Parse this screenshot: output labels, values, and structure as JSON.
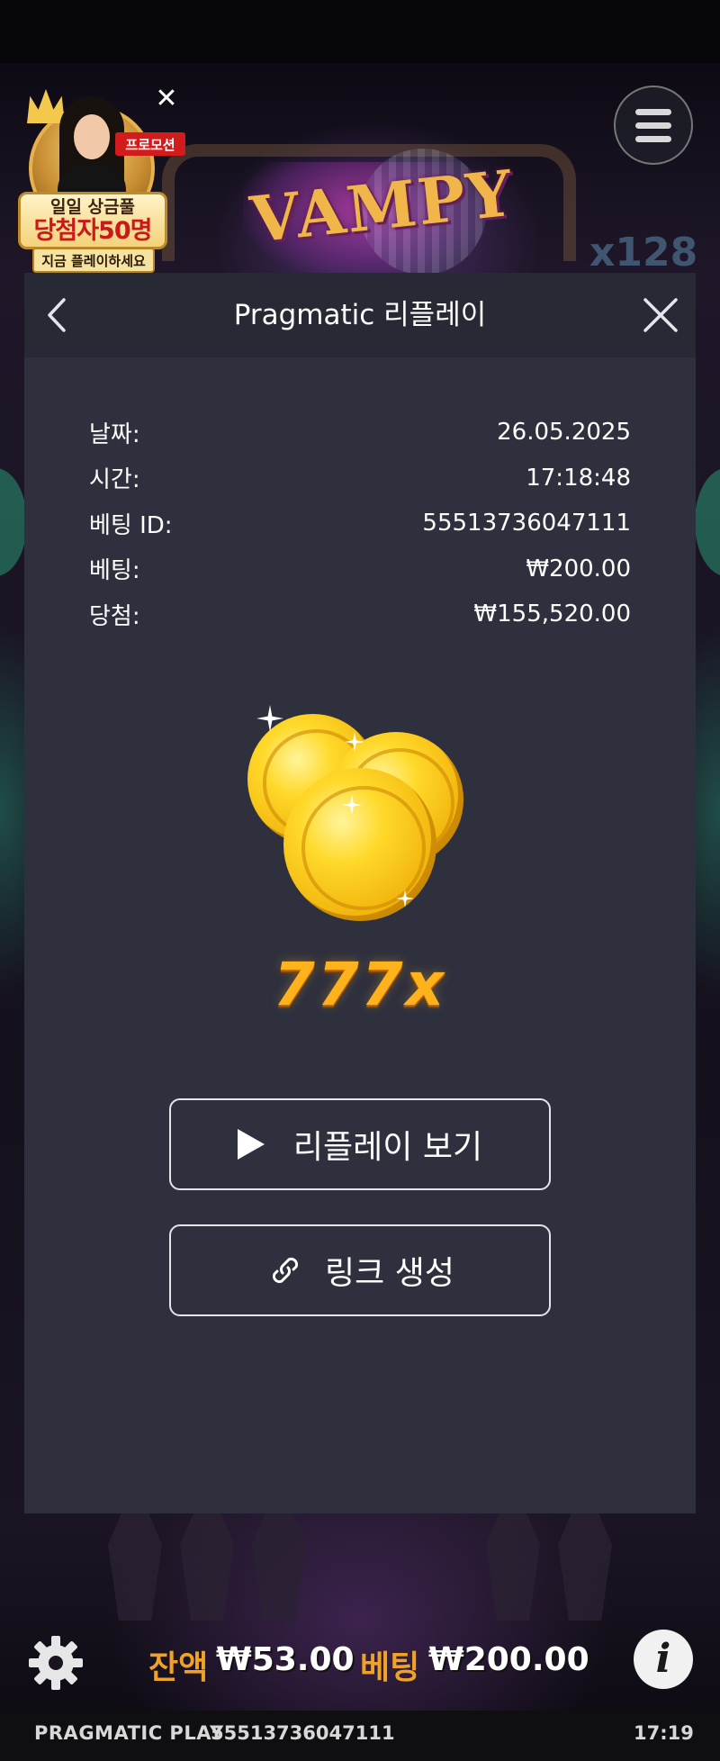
{
  "game": {
    "logo_text": "VAMPY",
    "multiplier_badge": "x128"
  },
  "promo": {
    "tag": "프로모션",
    "line1": "일일 상금풀",
    "line2": "당첨자50명",
    "cta": "지금 플레이하세요"
  },
  "modal": {
    "title": "Pragmatic 리플레이",
    "rows": [
      {
        "label": "날짜:",
        "value": "26.05.2025"
      },
      {
        "label": "시간:",
        "value": "17:18:48"
      },
      {
        "label": "베팅 ID:",
        "value": "55513736047111"
      },
      {
        "label": "베팅:",
        "value": "₩200.00"
      },
      {
        "label": "당첨:",
        "value": "₩155,520.00"
      }
    ],
    "multiplier": "777x",
    "replay_button": "리플레이 보기",
    "link_button": "링크 생성"
  },
  "bottom_bar": {
    "balance_label": "잔액",
    "balance_value": "₩53.00",
    "bet_label": "베팅",
    "bet_value": "₩200.00",
    "info_label": "i"
  },
  "footer": {
    "brand": "PRAGMATIC PLAY",
    "round_id": "55513736047111",
    "time": "17:19"
  },
  "colors": {
    "modal_bg": "#2e303e",
    "modal_header_bg": "#272935",
    "accent_gold": "#ffb21c",
    "label_orange": "#f0a227"
  }
}
